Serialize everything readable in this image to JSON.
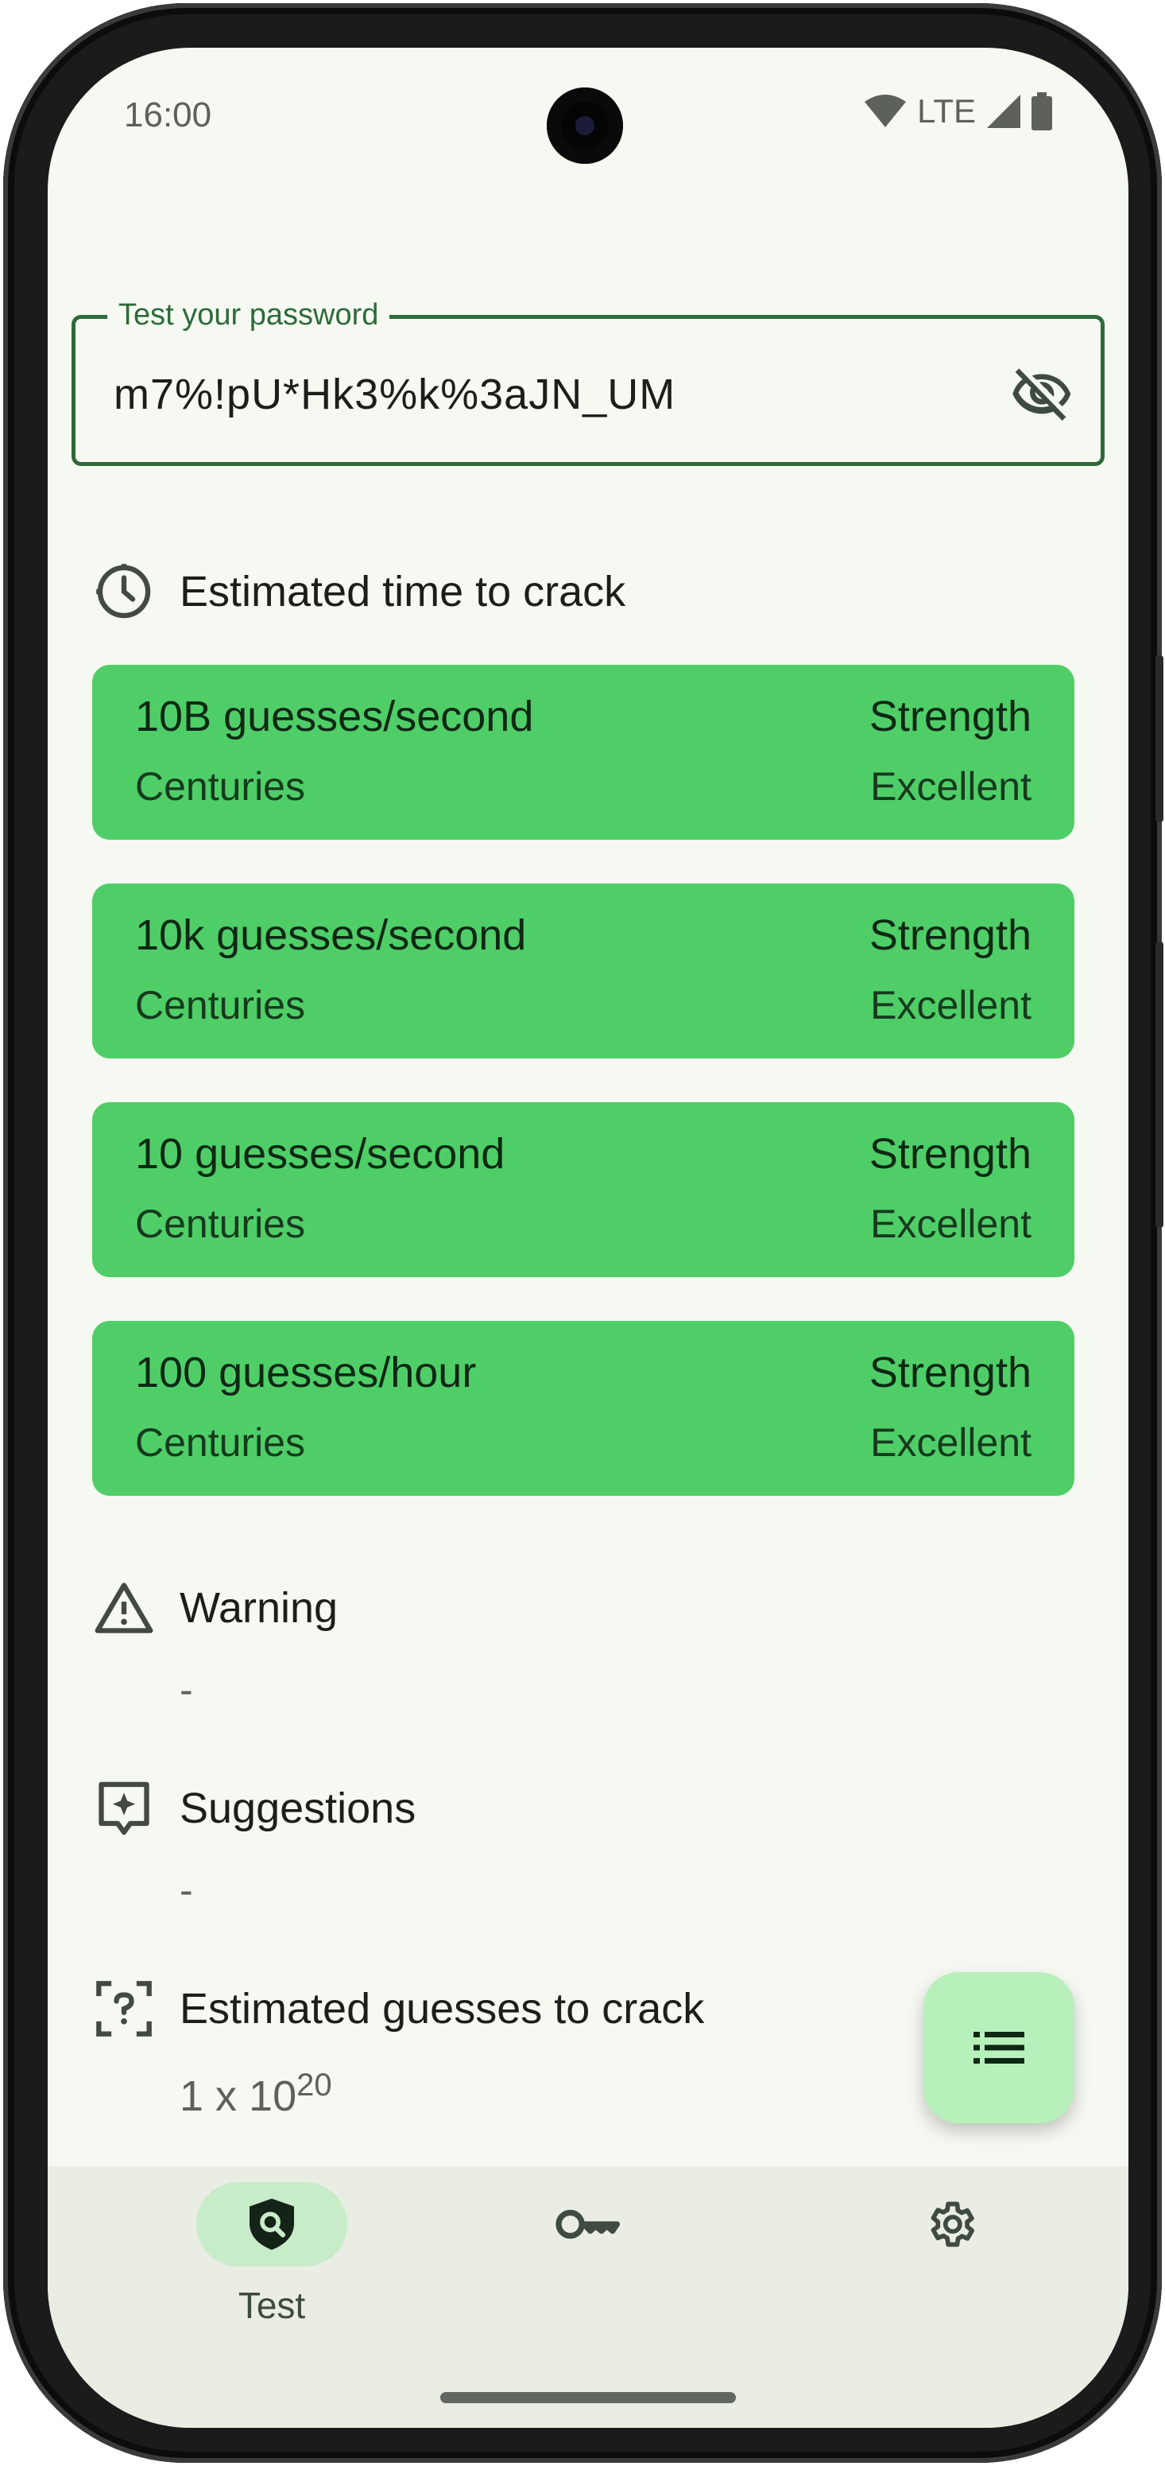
{
  "status_bar": {
    "time": "16:00",
    "network": "LTE",
    "icons": [
      "wifi-icon",
      "cellular-signal-icon",
      "battery-icon"
    ]
  },
  "password_field": {
    "label": "Test your password",
    "value": "m7%!pU*Hk3%k%3aJN_UM",
    "toggle_icon": "visibility-off-icon"
  },
  "crack_time": {
    "title": "Estimated time to crack",
    "icon": "clock-icon",
    "cards": [
      {
        "rate": "10B guesses/second",
        "time": "Centuries",
        "strength_label": "Strength",
        "strength_value": "Excellent"
      },
      {
        "rate": "10k guesses/second",
        "time": "Centuries",
        "strength_label": "Strength",
        "strength_value": "Excellent"
      },
      {
        "rate": "10 guesses/second",
        "time": "Centuries",
        "strength_label": "Strength",
        "strength_value": "Excellent"
      },
      {
        "rate": "100 guesses/hour",
        "time": "Centuries",
        "strength_label": "Strength",
        "strength_value": "Excellent"
      }
    ],
    "card_color": "#4fce68"
  },
  "warning": {
    "title": "Warning",
    "icon": "warning-triangle-icon",
    "value": "-"
  },
  "suggestions": {
    "title": "Suggestions",
    "icon": "sparkle-feedback-icon",
    "value": "-"
  },
  "guesses": {
    "title": "Estimated guesses to crack",
    "icon": "unknown-frame-icon",
    "base": "1 x 10",
    "exponent": "20"
  },
  "fab": {
    "icon": "list-icon"
  },
  "bottom_nav": {
    "items": [
      {
        "label": "Test",
        "icon": "shield-search-icon",
        "active": true
      },
      {
        "label": "",
        "icon": "key-icon",
        "active": false
      },
      {
        "label": "",
        "icon": "gear-icon",
        "active": false
      }
    ]
  },
  "colors": {
    "background": "#f6f9f1",
    "accent": "#2d6a3a",
    "fab": "#b8f0bc",
    "nav_active": "#c8ecc8"
  }
}
